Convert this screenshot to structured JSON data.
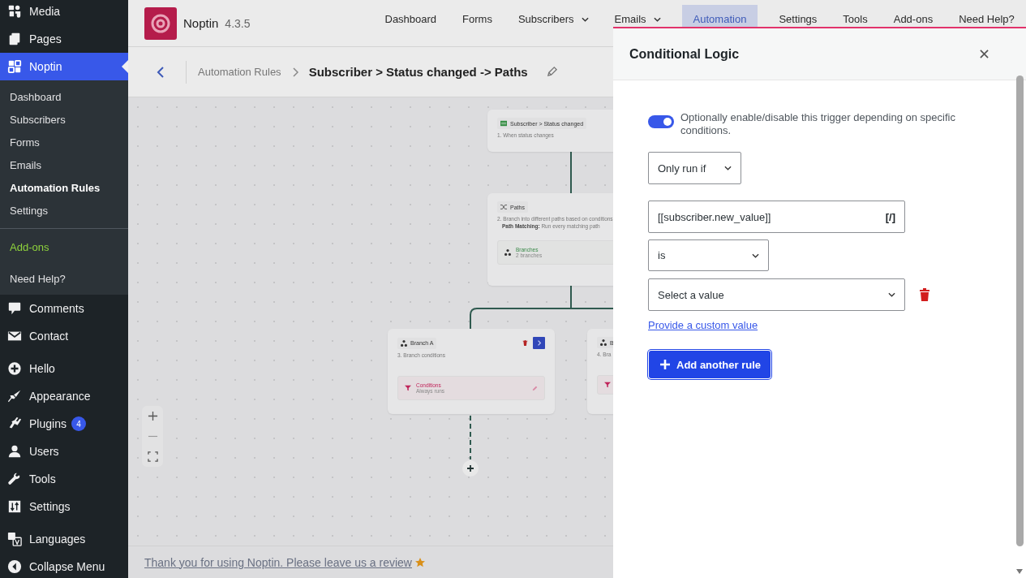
{
  "sidebar": {
    "sections": [
      {
        "kind": "menu",
        "items": [
          {
            "label": "Media",
            "selected": false
          },
          {
            "label": "Pages",
            "selected": false
          },
          {
            "label": "Noptin",
            "selected": true
          }
        ]
      },
      {
        "kind": "submenu",
        "items": [
          {
            "label": "Dashboard",
            "selected": false
          },
          {
            "label": "Subscribers",
            "selected": false
          },
          {
            "label": "Forms",
            "selected": false
          },
          {
            "label": "Emails",
            "selected": false
          },
          {
            "label": "Automation Rules",
            "selected": true
          },
          {
            "label": "Settings",
            "selected": false
          }
        ]
      },
      {
        "kind": "accent",
        "items": [
          {
            "label": "Add-ons",
            "selected": false
          }
        ]
      },
      {
        "kind": "submenu",
        "items": [
          {
            "label": "Need Help?",
            "selected": false
          }
        ]
      },
      {
        "kind": "menu",
        "items": [
          {
            "label": "Comments",
            "selected": false
          },
          {
            "label": "Contact",
            "selected": false
          }
        ]
      },
      {
        "kind": "menu",
        "items": [
          {
            "label": "Hello",
            "selected": false
          },
          {
            "label": "Appearance",
            "selected": false
          },
          {
            "label": "Plugins",
            "badge": "4",
            "selected": false
          },
          {
            "label": "Users",
            "selected": false
          },
          {
            "label": "Tools",
            "selected": false
          },
          {
            "label": "Settings",
            "selected": false
          }
        ]
      },
      {
        "kind": "menu",
        "items": [
          {
            "label": "Languages",
            "selected": false
          },
          {
            "label": "Collapse Menu",
            "selected": false
          }
        ]
      }
    ]
  },
  "header": {
    "brand": "Noptin",
    "version": "4.3.5",
    "nav": [
      {
        "label": "Dashboard",
        "dropdown": false,
        "selected": false
      },
      {
        "label": "Forms",
        "dropdown": false,
        "selected": false
      },
      {
        "label": "Subscribers",
        "dropdown": true,
        "selected": false
      },
      {
        "label": "Emails",
        "dropdown": true,
        "selected": false
      },
      {
        "label": "Automation",
        "dropdown": false,
        "selected": true
      },
      {
        "label": "Settings",
        "dropdown": false,
        "selected": false
      },
      {
        "label": "Tools",
        "dropdown": false,
        "selected": false
      },
      {
        "label": "Add-ons",
        "dropdown": false,
        "selected": false
      },
      {
        "label": "Need Help?",
        "dropdown": false,
        "selected": false
      }
    ]
  },
  "breadcrumb": {
    "parent": "Automation Rules",
    "title": "Subscriber > Status changed -> Paths"
  },
  "canvas": {
    "nodes": [
      {
        "kind": "trigger",
        "label": "Subscriber > Status changed",
        "description": "1. When status changes"
      },
      {
        "kind": "paths",
        "label": "Paths",
        "description": "2. Branch into different paths based on conditions.",
        "detail": "**Path Matching:** Run every matching path",
        "sub_title": "Branches",
        "sub_text": "2 branches"
      },
      {
        "kind": "branch",
        "label": "Branch A",
        "description": "3. Branch conditions",
        "sub_title": "Conditions",
        "sub_text": "Always runs"
      },
      {
        "kind": "branch",
        "label": "B",
        "description": "4. Bra"
      }
    ]
  },
  "footer": {
    "text": "Thank you for using Noptin. Please leave us a review"
  },
  "panel": {
    "title": "Conditional Logic",
    "enabled": true,
    "toggle_label": "Optionally enable/disable this trigger depending on specific conditions.",
    "mode": "Only run if",
    "rules": [
      {
        "field": "[[subscriber.new_value]]",
        "merge_tag": "[/]",
        "operator": "is",
        "value": "Select a value",
        "link": "Provide a custom value"
      }
    ],
    "add_button": "Add another rule"
  }
}
